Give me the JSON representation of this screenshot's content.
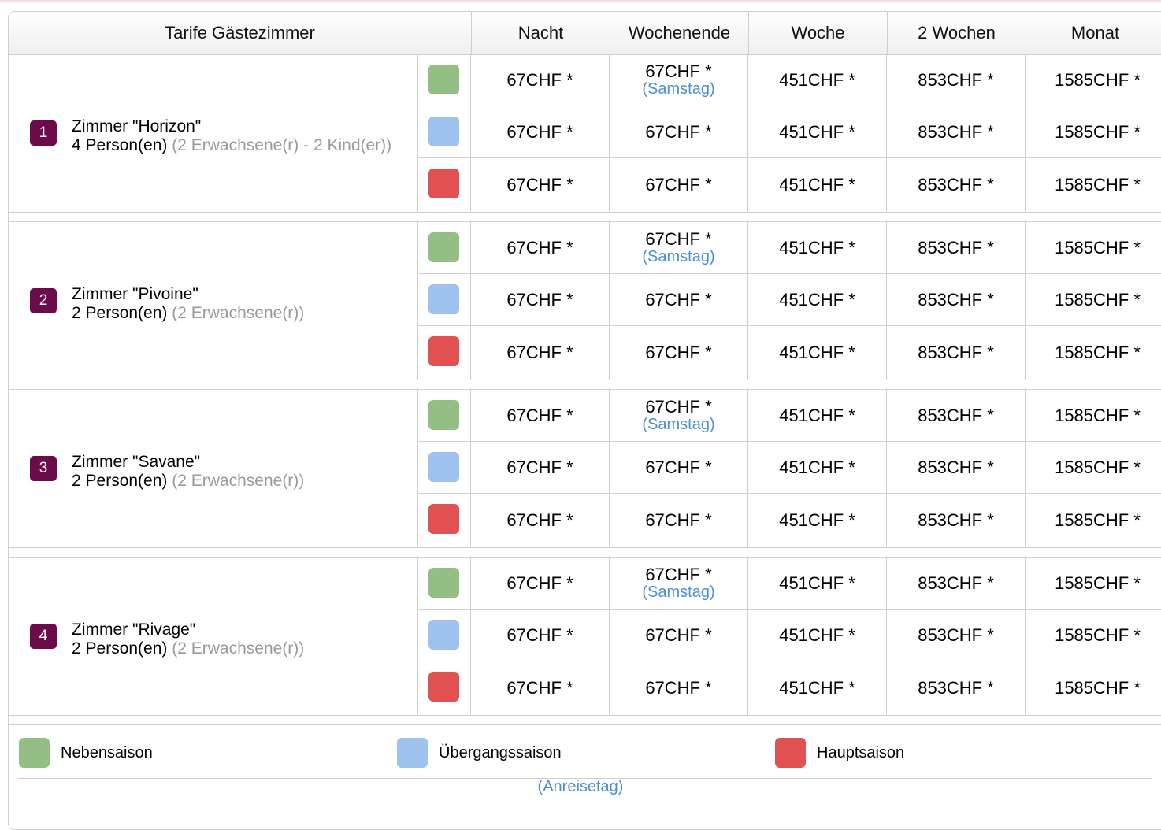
{
  "header": {
    "title": "Tarife Gästezimmer",
    "columns": [
      "Nacht",
      "Wochenende",
      "Woche",
      "2 Wochen",
      "Monat"
    ]
  },
  "season_colors": {
    "neben": "#93bf85",
    "uebergang": "#9cc2ed",
    "haupt": "#e05252"
  },
  "rooms": [
    {
      "number": "1",
      "name": "Zimmer \"Horizon\"",
      "persons": "4 Person(en)",
      "detail": "(2 Erwachsene(r) - 2 Kind(er))",
      "rows": [
        {
          "season": "neben",
          "nacht": "67CHF *",
          "wochenende": "67CHF *",
          "wochenende_note": "(Samstag)",
          "woche": "451CHF *",
          "zwei_wochen": "853CHF *",
          "monat": "1585CHF *"
        },
        {
          "season": "uebergang",
          "nacht": "67CHF *",
          "wochenende": "67CHF *",
          "woche": "451CHF *",
          "zwei_wochen": "853CHF *",
          "monat": "1585CHF *"
        },
        {
          "season": "haupt",
          "nacht": "67CHF *",
          "wochenende": "67CHF *",
          "woche": "451CHF *",
          "zwei_wochen": "853CHF *",
          "monat": "1585CHF *"
        }
      ]
    },
    {
      "number": "2",
      "name": "Zimmer \"Pivoine\"",
      "persons": "2 Person(en)",
      "detail": "(2 Erwachsene(r))",
      "rows": [
        {
          "season": "neben",
          "nacht": "67CHF *",
          "wochenende": "67CHF *",
          "wochenende_note": "(Samstag)",
          "woche": "451CHF *",
          "zwei_wochen": "853CHF *",
          "monat": "1585CHF *"
        },
        {
          "season": "uebergang",
          "nacht": "67CHF *",
          "wochenende": "67CHF *",
          "woche": "451CHF *",
          "zwei_wochen": "853CHF *",
          "monat": "1585CHF *"
        },
        {
          "season": "haupt",
          "nacht": "67CHF *",
          "wochenende": "67CHF *",
          "woche": "451CHF *",
          "zwei_wochen": "853CHF *",
          "monat": "1585CHF *"
        }
      ]
    },
    {
      "number": "3",
      "name": "Zimmer \"Savane\"",
      "persons": "2 Person(en)",
      "detail": "(2 Erwachsene(r))",
      "rows": [
        {
          "season": "neben",
          "nacht": "67CHF *",
          "wochenende": "67CHF *",
          "wochenende_note": "(Samstag)",
          "woche": "451CHF *",
          "zwei_wochen": "853CHF *",
          "monat": "1585CHF *"
        },
        {
          "season": "uebergang",
          "nacht": "67CHF *",
          "wochenende": "67CHF *",
          "woche": "451CHF *",
          "zwei_wochen": "853CHF *",
          "monat": "1585CHF *"
        },
        {
          "season": "haupt",
          "nacht": "67CHF *",
          "wochenende": "67CHF *",
          "woche": "451CHF *",
          "zwei_wochen": "853CHF *",
          "monat": "1585CHF *"
        }
      ]
    },
    {
      "number": "4",
      "name": "Zimmer \"Rivage\"",
      "persons": "2 Person(en)",
      "detail": "(2 Erwachsene(r))",
      "rows": [
        {
          "season": "neben",
          "nacht": "67CHF *",
          "wochenende": "67CHF *",
          "wochenende_note": "(Samstag)",
          "woche": "451CHF *",
          "zwei_wochen": "853CHF *",
          "monat": "1585CHF *"
        },
        {
          "season": "uebergang",
          "nacht": "67CHF *",
          "wochenende": "67CHF *",
          "woche": "451CHF *",
          "zwei_wochen": "853CHF *",
          "monat": "1585CHF *"
        },
        {
          "season": "haupt",
          "nacht": "67CHF *",
          "wochenende": "67CHF *",
          "woche": "451CHF *",
          "zwei_wochen": "853CHF *",
          "monat": "1585CHF *"
        }
      ]
    }
  ],
  "legend": [
    {
      "season": "neben",
      "label": "Nebensaison"
    },
    {
      "season": "uebergang",
      "label": "Übergangssaison"
    },
    {
      "season": "haupt",
      "label": "Hauptsaison"
    }
  ],
  "footer": {
    "note": "(Anreisetag)"
  }
}
